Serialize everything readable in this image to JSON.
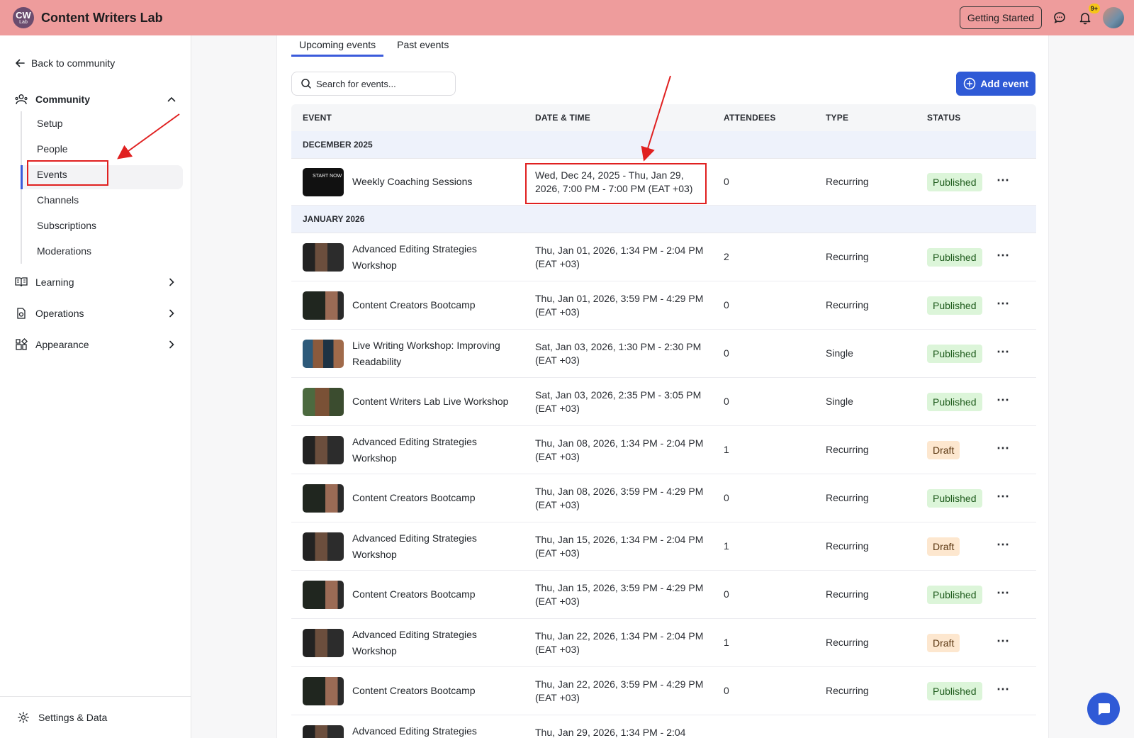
{
  "app": {
    "logo_main": "CW",
    "logo_sub": "Lab",
    "title": "Content Writers Lab"
  },
  "topbar": {
    "getting_started": "Getting Started",
    "notifications_badge": "9+",
    "icons": [
      "chat-icon",
      "bell-icon"
    ]
  },
  "sidebar": {
    "back_label": "Back to community",
    "community_label": "Community",
    "community_items": [
      "Setup",
      "People",
      "Events",
      "Channels",
      "Subscriptions",
      "Moderations"
    ],
    "active_item": "Events",
    "groups": [
      "Learning",
      "Operations",
      "Appearance"
    ],
    "settings_label": "Settings & Data"
  },
  "tabs": [
    {
      "label": "Upcoming events",
      "active": true
    },
    {
      "label": "Past events",
      "active": false
    }
  ],
  "search": {
    "placeholder": "Search for events..."
  },
  "add_event_label": "Add event",
  "table": {
    "headers": [
      "EVENT",
      "DATE & TIME",
      "ATTENDEES",
      "TYPE",
      "STATUS"
    ],
    "month_dec": "DECEMBER 2025",
    "month_jan": "JANUARY 2026",
    "rows": [
      {
        "thumb_text": "START NOW",
        "name": "Weekly Coaching Sessions",
        "date": "Wed, Dec 24, 2025 - Thu, Jan 29, 2026, 7:00 PM - 7:00 PM (EAT +03)",
        "attendees": "0",
        "type": "Recurring",
        "status": "Published"
      },
      {
        "name": "Advanced Editing Strategies Workshop",
        "date": "Thu, Jan 01, 2026, 1:34 PM - 2:04 PM (EAT +03)",
        "attendees": "2",
        "type": "Recurring",
        "status": "Published"
      },
      {
        "name": "Content Creators Bootcamp",
        "date": "Thu, Jan 01, 2026, 3:59 PM - 4:29 PM (EAT +03)",
        "attendees": "0",
        "type": "Recurring",
        "status": "Published"
      },
      {
        "name": "Live Writing Workshop: Improving Readability",
        "date": "Sat, Jan 03, 2026, 1:30 PM - 2:30 PM (EAT +03)",
        "attendees": "0",
        "type": "Single",
        "status": "Published"
      },
      {
        "name": "Content Writers Lab Live Workshop",
        "date": "Sat, Jan 03, 2026, 2:35 PM - 3:05 PM (EAT +03)",
        "attendees": "0",
        "type": "Single",
        "status": "Published"
      },
      {
        "name": "Advanced Editing Strategies Workshop",
        "date": "Thu, Jan 08, 2026, 1:34 PM - 2:04 PM (EAT +03)",
        "attendees": "1",
        "type": "Recurring",
        "status": "Draft"
      },
      {
        "name": "Content Creators Bootcamp",
        "date": "Thu, Jan 08, 2026, 3:59 PM - 4:29 PM (EAT +03)",
        "attendees": "0",
        "type": "Recurring",
        "status": "Published"
      },
      {
        "name": "Advanced Editing Strategies Workshop",
        "date": "Thu, Jan 15, 2026, 1:34 PM - 2:04 PM (EAT +03)",
        "attendees": "1",
        "type": "Recurring",
        "status": "Draft"
      },
      {
        "name": "Content Creators Bootcamp",
        "date": "Thu, Jan 15, 2026, 3:59 PM - 4:29 PM (EAT +03)",
        "attendees": "0",
        "type": "Recurring",
        "status": "Published"
      },
      {
        "name": "Advanced Editing Strategies Workshop",
        "date": "Thu, Jan 22, 2026, 1:34 PM - 2:04 PM (EAT +03)",
        "attendees": "1",
        "type": "Recurring",
        "status": "Draft"
      },
      {
        "name": "Content Creators Bootcamp",
        "date": "Thu, Jan 22, 2026, 3:59 PM - 4:29 PM (EAT +03)",
        "attendees": "0",
        "type": "Recurring",
        "status": "Published"
      },
      {
        "name": "Advanced Editing Strategies",
        "date": "Thu, Jan 29, 2026, 1:34 PM - 2:04",
        "attendees": "",
        "type": "",
        "status": ""
      }
    ]
  },
  "colors": {
    "topbar": "#ee9c9c",
    "accent": "#2f5ad6",
    "published_bg": "#dcf5d9",
    "draft_bg": "#fde7cf",
    "annotation": "#e02020"
  }
}
